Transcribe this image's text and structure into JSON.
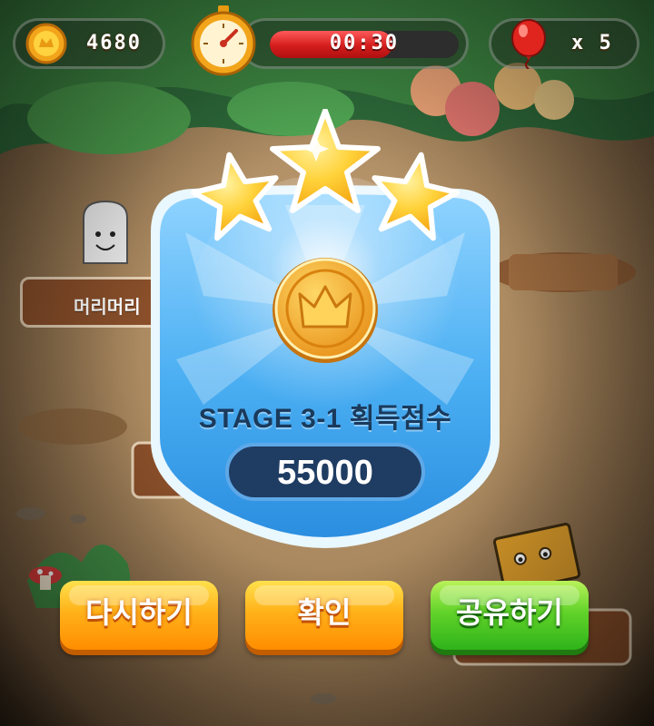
{
  "hud": {
    "coins": "4680",
    "timer": "00:30",
    "timer_progress": 0.65,
    "lives": "x 5"
  },
  "background": {
    "sign_left": "머리머리"
  },
  "result": {
    "stars_earned": 3,
    "stage_label": "STAGE 3-1 획득점수",
    "score": "55000"
  },
  "buttons": {
    "retry": "다시하기",
    "confirm": "확인",
    "share": "공유하기"
  },
  "colors": {
    "button_orange": "#ff9f0a",
    "button_green": "#45c120",
    "timer_red": "#d41d1d",
    "panel_blue": "#3ea2ef",
    "star_gold": "#ffc21a"
  }
}
